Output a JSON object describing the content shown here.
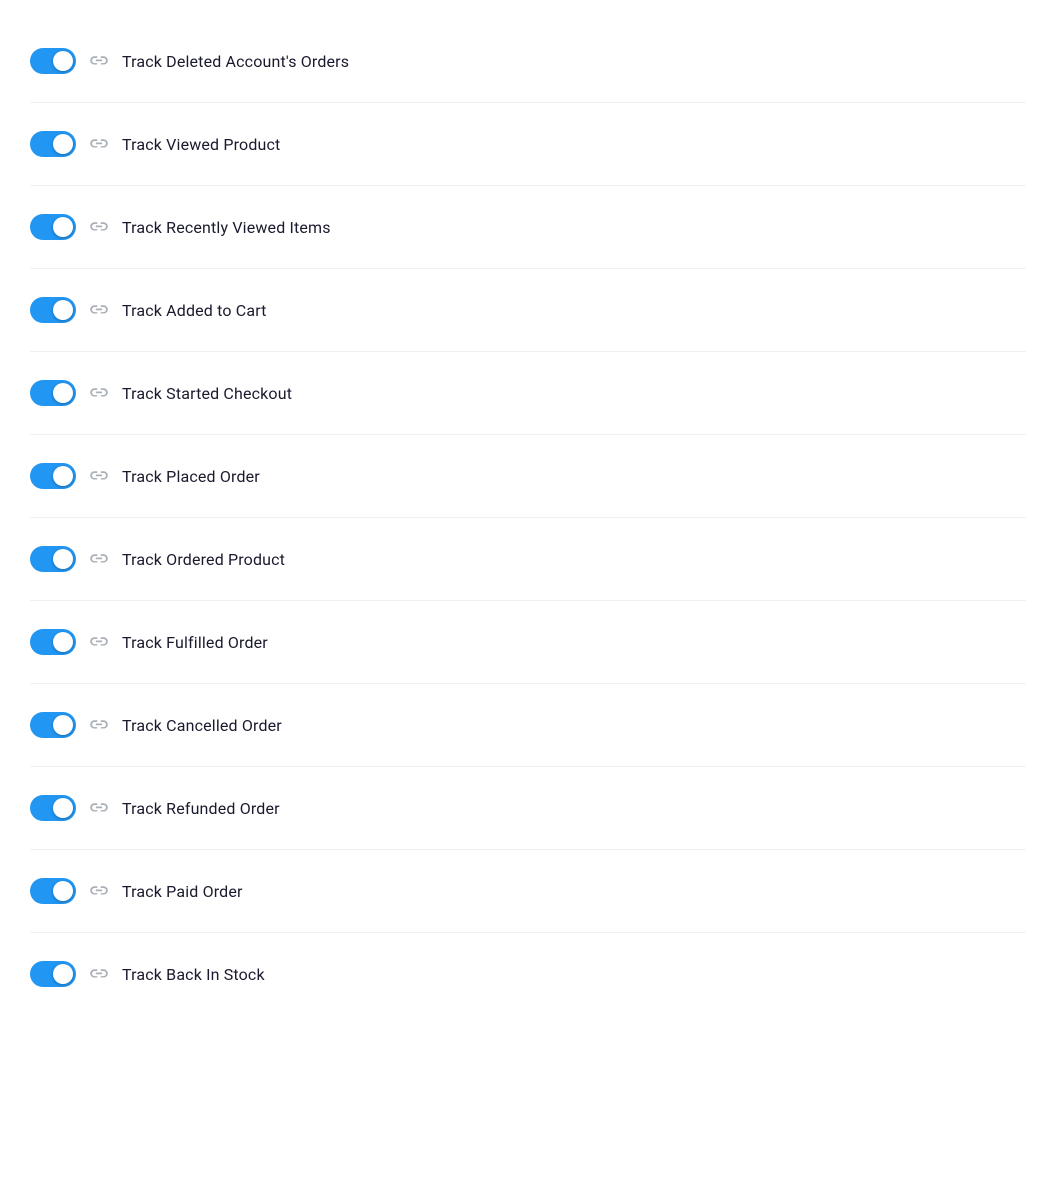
{
  "settings": {
    "items": [
      {
        "id": "track-deleted-account-orders",
        "label": "Track Deleted Account's Orders",
        "enabled": true
      },
      {
        "id": "track-viewed-product",
        "label": "Track Viewed Product",
        "enabled": true
      },
      {
        "id": "track-recently-viewed-items",
        "label": "Track Recently Viewed Items",
        "enabled": true
      },
      {
        "id": "track-added-to-cart",
        "label": "Track Added to Cart",
        "enabled": true
      },
      {
        "id": "track-started-checkout",
        "label": "Track Started Checkout",
        "enabled": true
      },
      {
        "id": "track-placed-order",
        "label": "Track Placed Order",
        "enabled": true
      },
      {
        "id": "track-ordered-product",
        "label": "Track Ordered Product",
        "enabled": true
      },
      {
        "id": "track-fulfilled-order",
        "label": "Track Fulfilled Order",
        "enabled": true
      },
      {
        "id": "track-cancelled-order",
        "label": "Track Cancelled Order",
        "enabled": true
      },
      {
        "id": "track-refunded-order",
        "label": "Track Refunded Order",
        "enabled": true
      },
      {
        "id": "track-paid-order",
        "label": "Track Paid Order",
        "enabled": true
      },
      {
        "id": "track-back-in-stock",
        "label": "Track Back In Stock",
        "enabled": true
      }
    ]
  }
}
